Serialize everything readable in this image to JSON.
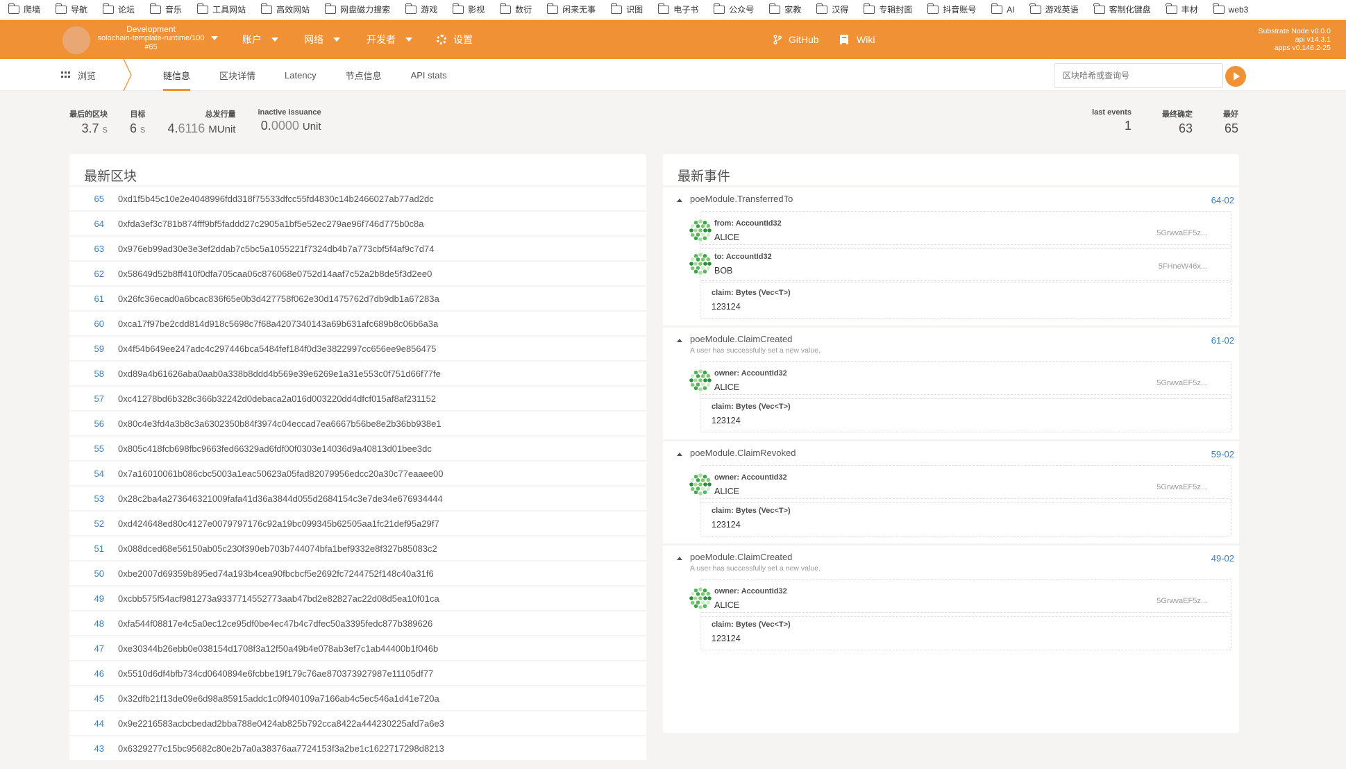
{
  "bookmarks": [
    "爬墙",
    "导航",
    "论坛",
    "音乐",
    "工具网站",
    "高效网站",
    "网盘磁力搜索",
    "游戏",
    "影视",
    "数衍",
    "闲来无事",
    "识图",
    "电子书",
    "公众号",
    "家教",
    "汉得",
    "专辑封面",
    "抖音账号",
    "AI",
    "游戏英语",
    "客制化键盘",
    "丰材",
    "web3"
  ],
  "header": {
    "chain_env": "Development",
    "chain_runtime": "solochain-template-runtime/100",
    "chain_block": "#65",
    "nav": [
      {
        "label": "账户"
      },
      {
        "label": "网络"
      },
      {
        "label": "开发者"
      },
      {
        "label": "设置"
      }
    ],
    "links": [
      {
        "label": "GitHub"
      },
      {
        "label": "Wiki"
      }
    ],
    "versions": [
      "Substrate Node v0.0.0",
      "api v14.3.1",
      "apps v0.146.2-25"
    ]
  },
  "subnav": {
    "browse_label": "浏览",
    "tabs": [
      "链信息",
      "区块详情",
      "Latency",
      "节点信息",
      "API stats"
    ],
    "active_tab": "链信息",
    "search_placeholder": "区块哈希或查询号"
  },
  "summary": {
    "last_block": {
      "label": "最后的区块",
      "value": "3.7",
      "unit": "s"
    },
    "target": {
      "label": "目标",
      "value": "6",
      "unit": "s"
    },
    "total_issuance": {
      "label": "总发行量",
      "value_int": "4.",
      "value_dec": "6116",
      "unit": "MUnit"
    },
    "inactive_issuance": {
      "label": "inactive issuance",
      "value_int": "0.",
      "value_dec": "0000",
      "unit": "Unit"
    },
    "last_events": {
      "label": "last events",
      "value": "1"
    },
    "finalized": {
      "label": "最终确定",
      "value": "63"
    },
    "best": {
      "label": "最好",
      "value": "65"
    }
  },
  "blocks": {
    "title": "最新区块",
    "rows": [
      {
        "num": "65",
        "hash": "0xd1f5b45c10e2e4048996fdd318f75533dfcc55fd4830c14b2466027ab77ad2dc"
      },
      {
        "num": "64",
        "hash": "0xfda3ef3c781b874fff9bf5faddd27c2905a1bf5e52ec279ae96f746d775b0c8a"
      },
      {
        "num": "63",
        "hash": "0x976eb99ad30e3e3ef2ddab7c5bc5a1055221f7324db4b7a773cbf5f4af9c7d74"
      },
      {
        "num": "62",
        "hash": "0x58649d52b8ff410f0dfa705caa06c876068e0752d14aaf7c52a2b8de5f3d2ee0"
      },
      {
        "num": "61",
        "hash": "0x26fc36ecad0a6bcac836f65e0b3d427758f062e30d1475762d7db9db1a67283a"
      },
      {
        "num": "60",
        "hash": "0xca17f97be2cdd814d918c5698c7f68a4207340143a69b631afc689b8c06b6a3a"
      },
      {
        "num": "59",
        "hash": "0x4f54b649ee247adc4c297446bca5484fef184f0d3e3822997cc656ee9e856475"
      },
      {
        "num": "58",
        "hash": "0xd89a4b61626aba0aab0a338b8ddd4b569e39e6269e1a31e553c0f751d66f77fe"
      },
      {
        "num": "57",
        "hash": "0xc41278bd6b328c366b32242d0debaca2a016d003220dd4dfcf015af8af231152"
      },
      {
        "num": "56",
        "hash": "0x80c4e3fd4a3b8c3a6302350b84f3974c04eccad7ea6667b56be8e2b36bb938e1"
      },
      {
        "num": "55",
        "hash": "0x805c418fcb698fbc9663fed66329ad6fdf00f0303e14036d9a40813d01bee3dc"
      },
      {
        "num": "54",
        "hash": "0x7a16010061b086cbc5003a1eac50623a05fad82079956edcc20a30c77eaaee00"
      },
      {
        "num": "53",
        "hash": "0x28c2ba4a273646321009fafa41d36a3844d055d2684154c3e7de34e676934444"
      },
      {
        "num": "52",
        "hash": "0xd424648ed80c4127e0079797176c92a19bc099345b62505aa1fc21def95a29f7"
      },
      {
        "num": "51",
        "hash": "0x088dced68e56150ab05c230f390eb703b744074bfa1bef9332e8f327b85083c2"
      },
      {
        "num": "50",
        "hash": "0xbe2007d69359b895ed74a193b4cea90fbcbcf5e2692fc7244752f148c40a31f6"
      },
      {
        "num": "49",
        "hash": "0xcbb575f54acf981273a9337714552773aab47bd2e82827ac22d08d5ea10f01ca"
      },
      {
        "num": "48",
        "hash": "0xfa544f08817e4c5a0ec12ce95df0be4ec47b4c7dfec50a3395fedc877b389626"
      },
      {
        "num": "47",
        "hash": "0xe30344b26ebb0e038154d1708f3a12f50a49b4e078ab3ef7c1ab44400b1f046b"
      },
      {
        "num": "46",
        "hash": "0x5510d6df4bfb734cd0640894e6fcbbe19f179c76ae870373927987e11105df77"
      },
      {
        "num": "45",
        "hash": "0x32dfb21f13de09e6d98a85915addc1c0f940109a7166ab4c5ec546a1d41e720a"
      },
      {
        "num": "44",
        "hash": "0x9e2216583acbcbedad2bba788e0424ab825b792cca8422a444230225afd7a6e3"
      },
      {
        "num": "43",
        "hash": "0x6329277c15bc95682c80e2b7a0a38376aa7724153f3a2be1c1622717298d8213"
      }
    ]
  },
  "events": {
    "title": "最新事件",
    "items": [
      {
        "name": "poeModule.TransferredTo",
        "desc": "",
        "id": "64-02",
        "params": [
          {
            "label": "from: AccountId32",
            "value": "ALICE",
            "addr": "5GrwvaEF5z...",
            "account": true
          },
          {
            "label": "to: AccountId32",
            "value": "BOB",
            "addr": "5FHneW46x...",
            "account": true
          },
          {
            "label": "claim: Bytes (Vec<T>)",
            "value": "123124",
            "addr": "",
            "account": false
          }
        ]
      },
      {
        "name": "poeModule.ClaimCreated",
        "desc": "A user has successfully set a new value.",
        "id": "61-02",
        "params": [
          {
            "label": "owner: AccountId32",
            "value": "ALICE",
            "addr": "5GrwvaEF5z...",
            "account": true
          },
          {
            "label": "claim: Bytes (Vec<T>)",
            "value": "123124",
            "addr": "",
            "account": false
          }
        ]
      },
      {
        "name": "poeModule.ClaimRevoked",
        "desc": "",
        "id": "59-02",
        "params": [
          {
            "label": "owner: AccountId32",
            "value": "ALICE",
            "addr": "5GrwvaEF5z...",
            "account": true
          },
          {
            "label": "claim: Bytes (Vec<T>)",
            "value": "123124",
            "addr": "",
            "account": false
          }
        ]
      },
      {
        "name": "poeModule.ClaimCreated",
        "desc": "A user has successfully set a new value.",
        "id": "49-02",
        "params": [
          {
            "label": "owner: AccountId32",
            "value": "ALICE",
            "addr": "5GrwvaEF5z...",
            "account": true
          },
          {
            "label": "claim: Bytes (Vec<T>)",
            "value": "123124",
            "addr": "",
            "account": false
          }
        ]
      }
    ]
  },
  "colors": {
    "accent": "#f19135",
    "link": "#3b7cbf",
    "background": "#f5f4f3"
  }
}
